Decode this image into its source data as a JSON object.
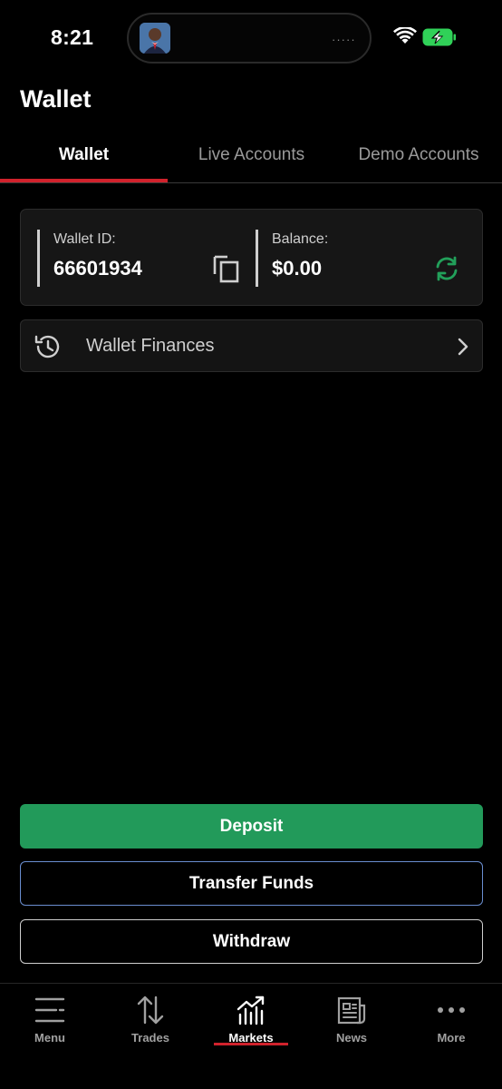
{
  "status_bar": {
    "time": "8:21",
    "island_dots": "·····",
    "icons": [
      "avatar",
      "wifi-icon",
      "battery-charging-icon"
    ]
  },
  "header": {
    "title": "Wallet"
  },
  "tabs": [
    {
      "label": "Wallet",
      "active": true
    },
    {
      "label": "Live Accounts",
      "active": false
    },
    {
      "label": "Demo Accounts",
      "active": false
    }
  ],
  "wallet_card": {
    "id_label": "Wallet ID:",
    "id_value": "66601934",
    "balance_label": "Balance:",
    "balance_value": "$0.00",
    "icons": [
      "copy-icon",
      "refresh-icon"
    ]
  },
  "finances": {
    "label": "Wallet Finances",
    "icons": [
      "history-icon",
      "chevron-right-icon"
    ]
  },
  "actions": {
    "deposit": "Deposit",
    "transfer": "Transfer Funds",
    "withdraw": "Withdraw"
  },
  "bottom_nav": [
    {
      "label": "Menu",
      "icon": "menu-icon",
      "active": false
    },
    {
      "label": "Trades",
      "icon": "trades-icon",
      "active": false
    },
    {
      "label": "Markets",
      "icon": "markets-icon",
      "active": true
    },
    {
      "label": "News",
      "icon": "news-icon",
      "active": false
    },
    {
      "label": "More",
      "icon": "more-icon",
      "active": false
    }
  ],
  "colors": {
    "accent_red": "#d0222c",
    "deposit_green": "#229a5a",
    "refresh_green": "#22a05a",
    "transfer_border": "#6a8ed0",
    "background": "#000000"
  }
}
